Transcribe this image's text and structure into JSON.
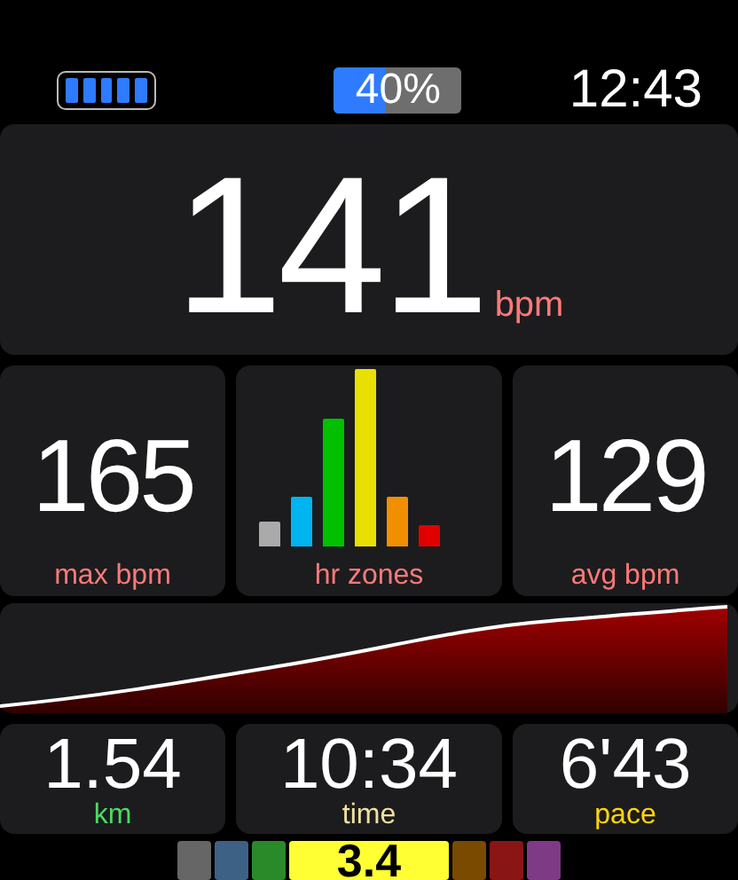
{
  "status_bar": {
    "progress": {
      "level": 0.4,
      "reading": "40%"
    },
    "time": "12:43"
  },
  "heart_rate": {
    "value": "141",
    "unit": "bpm"
  },
  "stats": [
    {
      "kind": "value",
      "value": "165",
      "label": "max bpm"
    },
    {
      "kind": "zones",
      "label": "hr zones"
    },
    {
      "kind": "value",
      "value": "129",
      "label": "avg bpm"
    }
  ],
  "metrics": [
    {
      "value": "1.54",
      "label": "km",
      "color": "#4cd964"
    },
    {
      "value": "10:34",
      "label": "time",
      "color": "#f0e0a0"
    },
    {
      "value": "6'43",
      "label": "pace",
      "color": "#ffd60a"
    }
  ],
  "zone_strip": [
    {
      "color": "#666666",
      "selected": false
    },
    {
      "color": "#3d6185",
      "selected": false
    },
    {
      "color": "#2a8a2a",
      "selected": false
    },
    {
      "color": "#ffff33",
      "selected": true,
      "label": "3.4"
    },
    {
      "color": "#7a4a00",
      "selected": false
    },
    {
      "color": "#8a1515",
      "selected": false
    },
    {
      "color": "#7f3a85",
      "selected": false
    }
  ]
}
